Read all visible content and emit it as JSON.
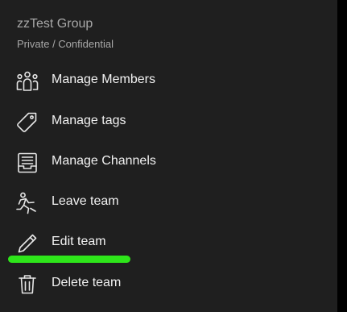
{
  "header": {
    "title": "zzTest Group",
    "subtitle": "Private / Confidential"
  },
  "menu": {
    "items": [
      {
        "label": "Manage Members",
        "icon": "team-members-icon"
      },
      {
        "label": "Manage tags",
        "icon": "tag-icon"
      },
      {
        "label": "Manage Channels",
        "icon": "channels-icon"
      },
      {
        "label": "Leave team",
        "icon": "running-person-icon"
      },
      {
        "label": "Edit team",
        "icon": "pencil-icon"
      },
      {
        "label": "Delete team",
        "icon": "trash-icon"
      }
    ]
  },
  "colors": {
    "background": "#1f1f1f",
    "text": "#f2f2f2",
    "muted_text": "#a8a8a8",
    "annotation": "#2ee51a"
  }
}
